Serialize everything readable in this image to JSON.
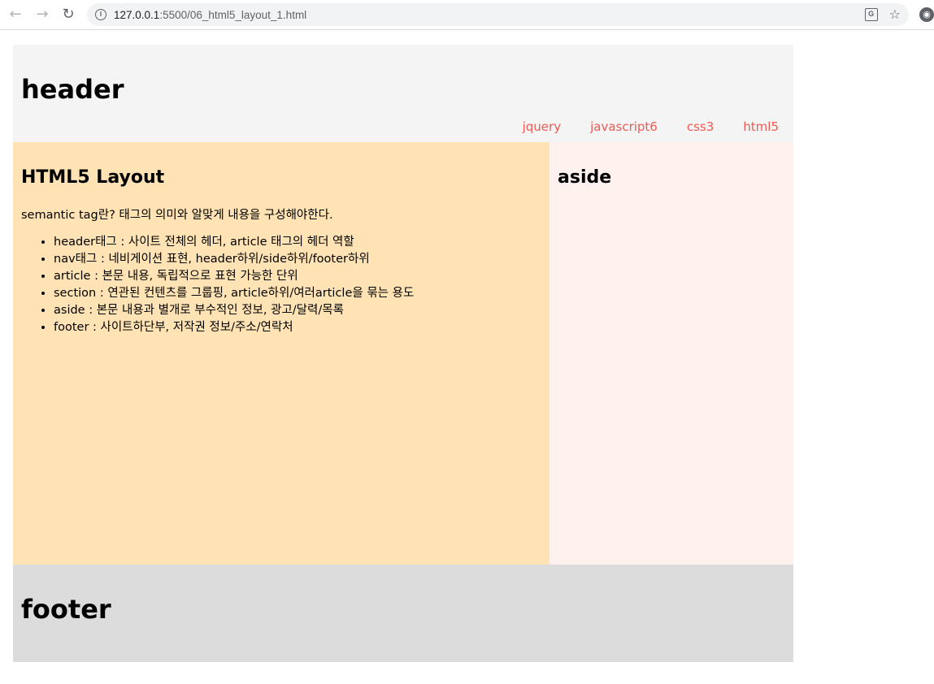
{
  "browser": {
    "url_host": "127.0.0.1",
    "url_rest": ":5500/06_html5_layout_1.html",
    "icons": {
      "back": "←",
      "forward": "→",
      "reload": "↻",
      "info": "i",
      "translate": "G",
      "star": "☆",
      "extension": "◉"
    }
  },
  "header": {
    "title": "header",
    "nav": [
      "jquery",
      "javascript6",
      "css3",
      "html5"
    ]
  },
  "main": {
    "title": "HTML5 Layout",
    "intro": "semantic tag란? 태그의 의미와 알맞게 내용을 구성해야한다.",
    "items": [
      "header태그 : 사이트 전체의 헤더, article 태그의 헤더 역할",
      "nav태그 : 네비게이션 표현, header하위/side하위/footer하위",
      "article : 본문 내용, 독립적으로 표현 가능한 단위",
      "section : 연관된 컨텐츠를 그룹핑, article하위/여러article을 묶는 용도",
      "aside : 본문 내용과 별개로 부수적인 정보, 광고/달력/목록",
      "footer : 사이트하단부, 저작권 정보/주소/연락처"
    ]
  },
  "aside": {
    "title": "aside"
  },
  "footer": {
    "title": "footer"
  },
  "colors": {
    "header_bg": "#f4f4f5",
    "nav_link": "#ee5a52",
    "main_bg": "#ffe3b4",
    "aside_bg": "#fff2ee",
    "footer_bg": "#dcdcdc"
  }
}
